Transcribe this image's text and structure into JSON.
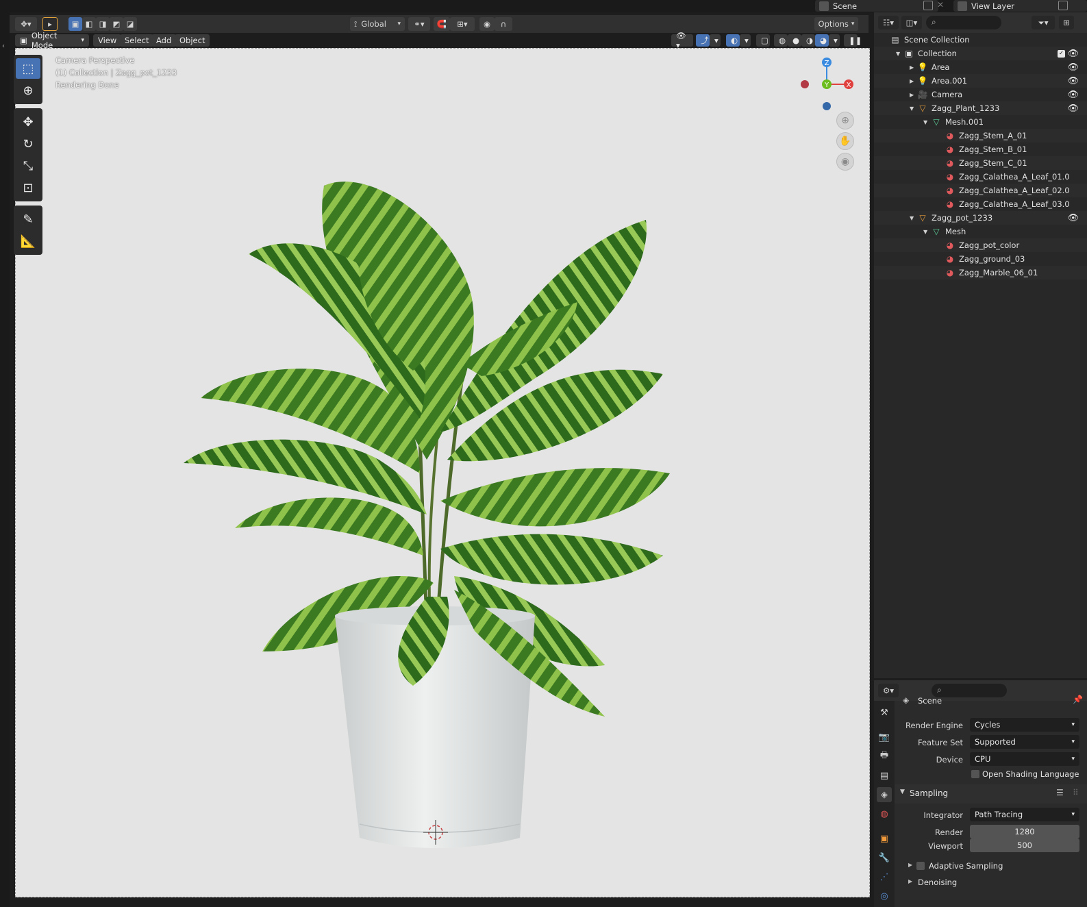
{
  "top_bar": {
    "scene_label": "Scene",
    "view_layer_label": "View Layer"
  },
  "viewport_toolbar": {
    "transform_orientation": "Global",
    "options_label": "Options"
  },
  "viewport_header": {
    "mode": "Object Mode",
    "menus": [
      "View",
      "Select",
      "Add",
      "Object"
    ]
  },
  "viewport": {
    "overlay_lines": [
      "Camera Perspective",
      "(1) Collection | Zagg_pot_1233",
      "Rendering Done"
    ],
    "gizmo": {
      "z": "Z",
      "y": "Y",
      "x": "X"
    }
  },
  "outliner": {
    "rows": [
      {
        "label": "Scene Collection",
        "icon": "scene-collection-icon",
        "depth": 0,
        "expand": "",
        "visible": false
      },
      {
        "label": "Collection",
        "icon": "collection-icon",
        "depth": 1,
        "expand": "down",
        "visible": true
      },
      {
        "label": "Area",
        "icon": "light-icon",
        "depth": 2,
        "expand": "right",
        "visible": true
      },
      {
        "label": "Area.001",
        "icon": "light-icon",
        "depth": 2,
        "expand": "right",
        "visible": true
      },
      {
        "label": "Camera",
        "icon": "camera-icon",
        "depth": 2,
        "expand": "right",
        "visible": true
      },
      {
        "label": "Zagg_Plant_1233",
        "icon": "mesh-object-icon",
        "depth": 2,
        "expand": "down",
        "visible": true
      },
      {
        "label": "Mesh.001",
        "icon": "mesh-data-icon",
        "depth": 3,
        "expand": "down",
        "visible": false
      },
      {
        "label": "Zagg_Stem_A_01",
        "icon": "material-icon",
        "depth": 4,
        "expand": "",
        "visible": false
      },
      {
        "label": "Zagg_Stem_B_01",
        "icon": "material-icon",
        "depth": 4,
        "expand": "",
        "visible": false
      },
      {
        "label": "Zagg_Stem_C_01",
        "icon": "material-icon",
        "depth": 4,
        "expand": "",
        "visible": false
      },
      {
        "label": "Zagg_Calathea_A_Leaf_01.0",
        "icon": "material-icon",
        "depth": 4,
        "expand": "",
        "visible": false
      },
      {
        "label": "Zagg_Calathea_A_Leaf_02.0",
        "icon": "material-icon",
        "depth": 4,
        "expand": "",
        "visible": false
      },
      {
        "label": "Zagg_Calathea_A_Leaf_03.0",
        "icon": "material-icon",
        "depth": 4,
        "expand": "",
        "visible": false
      },
      {
        "label": "Zagg_pot_1233",
        "icon": "mesh-object-icon",
        "depth": 2,
        "expand": "down",
        "visible": true
      },
      {
        "label": "Mesh",
        "icon": "mesh-data-icon",
        "depth": 3,
        "expand": "down",
        "visible": false
      },
      {
        "label": "Zagg_pot_color",
        "icon": "material-icon",
        "depth": 4,
        "expand": "",
        "visible": false
      },
      {
        "label": "Zagg_ground_03",
        "icon": "material-icon",
        "depth": 4,
        "expand": "",
        "visible": false
      },
      {
        "label": "Zagg_Marble_06_01",
        "icon": "material-icon",
        "depth": 4,
        "expand": "",
        "visible": false
      }
    ]
  },
  "properties": {
    "context_title": "Scene",
    "render_engine": {
      "label": "Render Engine",
      "value": "Cycles"
    },
    "feature_set": {
      "label": "Feature Set",
      "value": "Supported"
    },
    "device": {
      "label": "Device",
      "value": "CPU"
    },
    "osl_label": "Open Shading Language",
    "sampling": {
      "title": "Sampling",
      "integrator": {
        "label": "Integrator",
        "value": "Path Tracing"
      },
      "render": {
        "label": "Render",
        "value": "1280"
      },
      "viewport": {
        "label": "Viewport",
        "value": "500"
      }
    },
    "adaptive_sampling_label": "Adaptive Sampling",
    "denoising_label": "Denoising"
  },
  "colors": {
    "accent": "#4772b3",
    "leaf_dark": "#2f6b1e",
    "leaf_light": "#9fcc55",
    "pot": "#e8eaea",
    "axis_x": "#e0413f",
    "axis_y": "#6bbd1e",
    "axis_z": "#3b8be0"
  }
}
